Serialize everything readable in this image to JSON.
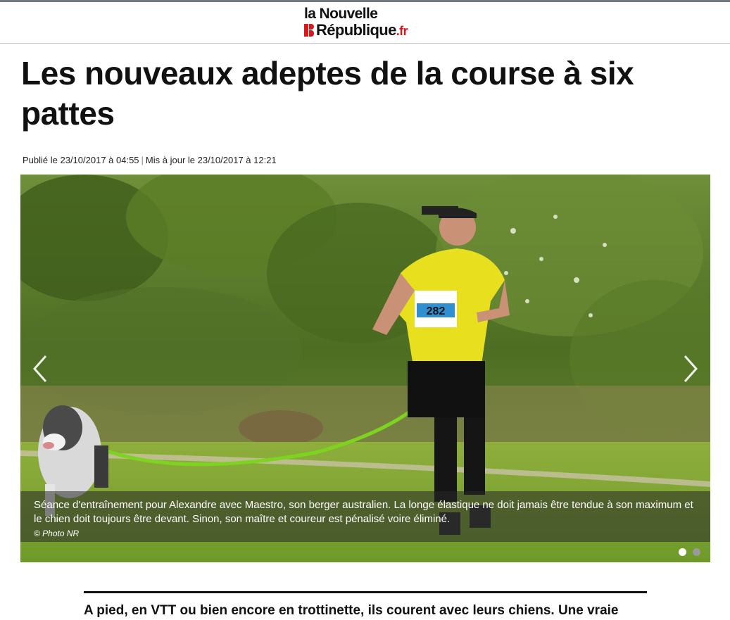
{
  "site": {
    "logo_line1": "la Nouvelle",
    "logo_line2": "République",
    "logo_tld": ".fr",
    "brand_red": "#d7181f"
  },
  "article": {
    "title": "Les nouveaux adeptes de la course à six pattes",
    "published": "Publié le 23/10/2017 à 04:55",
    "separator": "|",
    "updated": "Mis à jour le 23/10/2017 à 12:21",
    "lead": "A pied, en VTT ou bien encore en trottinette, ils courent avec leurs chiens. Une vraie"
  },
  "gallery": {
    "caption": "Séance d'entraînement pour Alexandre avec Maestro, son berger australien. La longe élastique ne doit jamais être tendue à son maximum et le chien doit toujours être devant. Sinon, son maître et coureur est pénalisé voire éliminé.",
    "credit": "© Photo NR",
    "bib_number": "282",
    "prev_icon": "chevron-left-icon",
    "next_icon": "chevron-right-icon",
    "slide_count": 2,
    "active_slide": 1,
    "dot_active_color": "#ffffff",
    "dot_inactive_color": "#9a9a9a"
  }
}
